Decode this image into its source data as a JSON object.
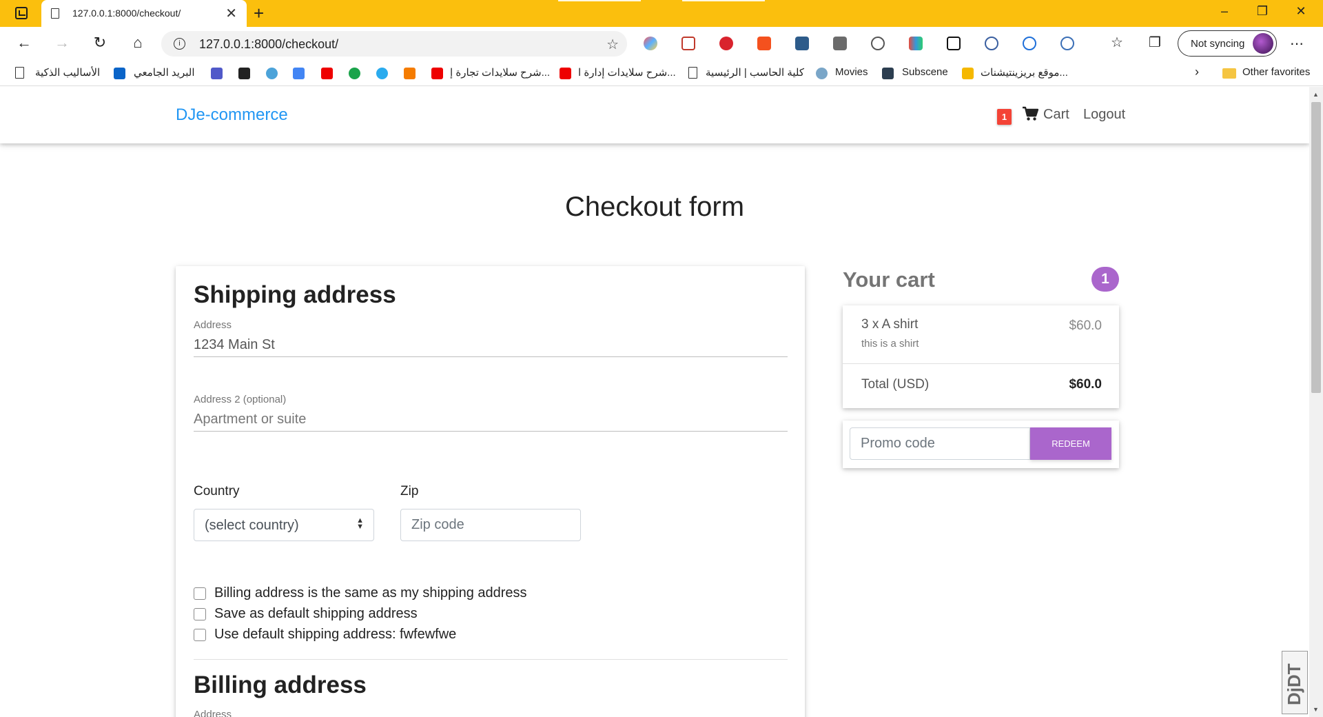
{
  "browser": {
    "tab_title": "127.0.0.1:8000/checkout/",
    "tab_close": "✕",
    "new_tab": "+",
    "url": "127.0.0.1:8000/checkout/",
    "sync_label": "Not syncing",
    "more": "⋯",
    "window_controls": {
      "minimize": "–",
      "restore": "❐",
      "close": "✕"
    }
  },
  "favorites": [
    {
      "label": "الأساليب الذكية",
      "icon": "doc-icon"
    },
    {
      "label": "البريد الجامعي",
      "icon": "outlook-icon"
    },
    {
      "label": "شرح سلايدات تجارة إ...",
      "icon": "youtube-icon"
    },
    {
      "label": "شرح سلايدات إدارة ا...",
      "icon": "youtube-icon"
    },
    {
      "label": "كلية الحاسب | الرئيسية",
      "icon": "doc-icon"
    },
    {
      "label": "Movies",
      "icon": "movies-icon"
    },
    {
      "label": "Subscene",
      "icon": "subscene-icon"
    },
    {
      "label": "موقع بريزينتيشنات...",
      "icon": "bookmark-icon"
    },
    {
      "label": "Other favorites",
      "icon": "folder-icon"
    }
  ],
  "site": {
    "brand": "DJe-commerce",
    "cart_count": "1",
    "cart_label": "Cart",
    "logout_label": "Logout"
  },
  "page": {
    "title": "Checkout form"
  },
  "shipping": {
    "heading": "Shipping address",
    "address_label": "Address",
    "address_value": "1234 Main St",
    "address2_label": "Address 2 (optional)",
    "address2_placeholder": "Apartment or suite",
    "country_label": "Country",
    "country_selected": "(select country)",
    "zip_label": "Zip",
    "zip_placeholder": "Zip code",
    "checkboxes": [
      {
        "label": "Billing address is the same as my shipping address",
        "checked": false
      },
      {
        "label": "Save as default shipping address",
        "checked": false
      },
      {
        "label": "Use default shipping address: fwfewfwe",
        "checked": false
      }
    ]
  },
  "billing": {
    "heading": "Billing address",
    "address_label": "Address"
  },
  "cart": {
    "heading": "Your cart",
    "count": "1",
    "items": [
      {
        "name": "3 x A shirt",
        "description": "this is a shirt",
        "price": "$60.0"
      }
    ],
    "total_label": "Total (USD)",
    "total_value": "$60.0",
    "promo_placeholder": "Promo code",
    "redeem_label": "REDEEM"
  },
  "widget": {
    "label": "DjDT"
  },
  "colors": {
    "tabbar": "#fbbf0d",
    "brand_blue": "#2196f3",
    "accent_purple": "#aa66cc",
    "badge_red": "#f44336"
  }
}
